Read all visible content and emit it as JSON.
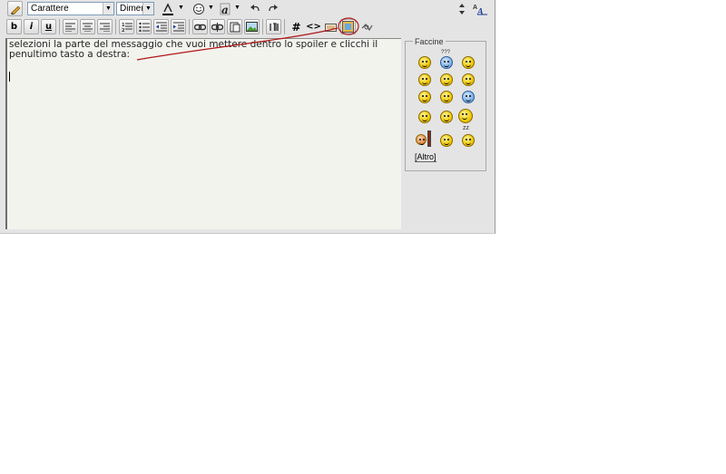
{
  "toolbar": {
    "font_select": "Carattere",
    "size_select": "Dimer",
    "buttons": {
      "bold": "b",
      "italic": "i",
      "underline": "u",
      "hash": "#",
      "code": "<>"
    }
  },
  "textarea": {
    "value": "selezioni la parte del messaggio che vuoi mettere dentro lo spoiler e clicchi il penultimo tasto a destra:"
  },
  "smiley_panel": {
    "title": "Faccine",
    "more_link": "[Altro]"
  },
  "annotation": {
    "color": "#b01818"
  }
}
